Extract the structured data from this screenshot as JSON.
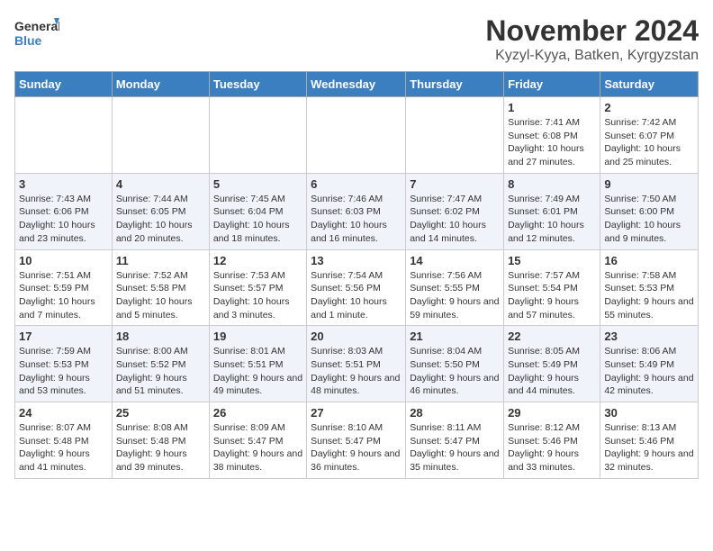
{
  "logo": {
    "line1": "General",
    "line2": "Blue"
  },
  "title": "November 2024",
  "location": "Kyzyl-Kyya, Batken, Kyrgyzstan",
  "weekdays": [
    "Sunday",
    "Monday",
    "Tuesday",
    "Wednesday",
    "Thursday",
    "Friday",
    "Saturday"
  ],
  "weeks": [
    [
      {
        "day": "",
        "detail": ""
      },
      {
        "day": "",
        "detail": ""
      },
      {
        "day": "",
        "detail": ""
      },
      {
        "day": "",
        "detail": ""
      },
      {
        "day": "",
        "detail": ""
      },
      {
        "day": "1",
        "detail": "Sunrise: 7:41 AM\nSunset: 6:08 PM\nDaylight: 10 hours and 27 minutes."
      },
      {
        "day": "2",
        "detail": "Sunrise: 7:42 AM\nSunset: 6:07 PM\nDaylight: 10 hours and 25 minutes."
      }
    ],
    [
      {
        "day": "3",
        "detail": "Sunrise: 7:43 AM\nSunset: 6:06 PM\nDaylight: 10 hours and 23 minutes."
      },
      {
        "day": "4",
        "detail": "Sunrise: 7:44 AM\nSunset: 6:05 PM\nDaylight: 10 hours and 20 minutes."
      },
      {
        "day": "5",
        "detail": "Sunrise: 7:45 AM\nSunset: 6:04 PM\nDaylight: 10 hours and 18 minutes."
      },
      {
        "day": "6",
        "detail": "Sunrise: 7:46 AM\nSunset: 6:03 PM\nDaylight: 10 hours and 16 minutes."
      },
      {
        "day": "7",
        "detail": "Sunrise: 7:47 AM\nSunset: 6:02 PM\nDaylight: 10 hours and 14 minutes."
      },
      {
        "day": "8",
        "detail": "Sunrise: 7:49 AM\nSunset: 6:01 PM\nDaylight: 10 hours and 12 minutes."
      },
      {
        "day": "9",
        "detail": "Sunrise: 7:50 AM\nSunset: 6:00 PM\nDaylight: 10 hours and 9 minutes."
      }
    ],
    [
      {
        "day": "10",
        "detail": "Sunrise: 7:51 AM\nSunset: 5:59 PM\nDaylight: 10 hours and 7 minutes."
      },
      {
        "day": "11",
        "detail": "Sunrise: 7:52 AM\nSunset: 5:58 PM\nDaylight: 10 hours and 5 minutes."
      },
      {
        "day": "12",
        "detail": "Sunrise: 7:53 AM\nSunset: 5:57 PM\nDaylight: 10 hours and 3 minutes."
      },
      {
        "day": "13",
        "detail": "Sunrise: 7:54 AM\nSunset: 5:56 PM\nDaylight: 10 hours and 1 minute."
      },
      {
        "day": "14",
        "detail": "Sunrise: 7:56 AM\nSunset: 5:55 PM\nDaylight: 9 hours and 59 minutes."
      },
      {
        "day": "15",
        "detail": "Sunrise: 7:57 AM\nSunset: 5:54 PM\nDaylight: 9 hours and 57 minutes."
      },
      {
        "day": "16",
        "detail": "Sunrise: 7:58 AM\nSunset: 5:53 PM\nDaylight: 9 hours and 55 minutes."
      }
    ],
    [
      {
        "day": "17",
        "detail": "Sunrise: 7:59 AM\nSunset: 5:53 PM\nDaylight: 9 hours and 53 minutes."
      },
      {
        "day": "18",
        "detail": "Sunrise: 8:00 AM\nSunset: 5:52 PM\nDaylight: 9 hours and 51 minutes."
      },
      {
        "day": "19",
        "detail": "Sunrise: 8:01 AM\nSunset: 5:51 PM\nDaylight: 9 hours and 49 minutes."
      },
      {
        "day": "20",
        "detail": "Sunrise: 8:03 AM\nSunset: 5:51 PM\nDaylight: 9 hours and 48 minutes."
      },
      {
        "day": "21",
        "detail": "Sunrise: 8:04 AM\nSunset: 5:50 PM\nDaylight: 9 hours and 46 minutes."
      },
      {
        "day": "22",
        "detail": "Sunrise: 8:05 AM\nSunset: 5:49 PM\nDaylight: 9 hours and 44 minutes."
      },
      {
        "day": "23",
        "detail": "Sunrise: 8:06 AM\nSunset: 5:49 PM\nDaylight: 9 hours and 42 minutes."
      }
    ],
    [
      {
        "day": "24",
        "detail": "Sunrise: 8:07 AM\nSunset: 5:48 PM\nDaylight: 9 hours and 41 minutes."
      },
      {
        "day": "25",
        "detail": "Sunrise: 8:08 AM\nSunset: 5:48 PM\nDaylight: 9 hours and 39 minutes."
      },
      {
        "day": "26",
        "detail": "Sunrise: 8:09 AM\nSunset: 5:47 PM\nDaylight: 9 hours and 38 minutes."
      },
      {
        "day": "27",
        "detail": "Sunrise: 8:10 AM\nSunset: 5:47 PM\nDaylight: 9 hours and 36 minutes."
      },
      {
        "day": "28",
        "detail": "Sunrise: 8:11 AM\nSunset: 5:47 PM\nDaylight: 9 hours and 35 minutes."
      },
      {
        "day": "29",
        "detail": "Sunrise: 8:12 AM\nSunset: 5:46 PM\nDaylight: 9 hours and 33 minutes."
      },
      {
        "day": "30",
        "detail": "Sunrise: 8:13 AM\nSunset: 5:46 PM\nDaylight: 9 hours and 32 minutes."
      }
    ]
  ]
}
